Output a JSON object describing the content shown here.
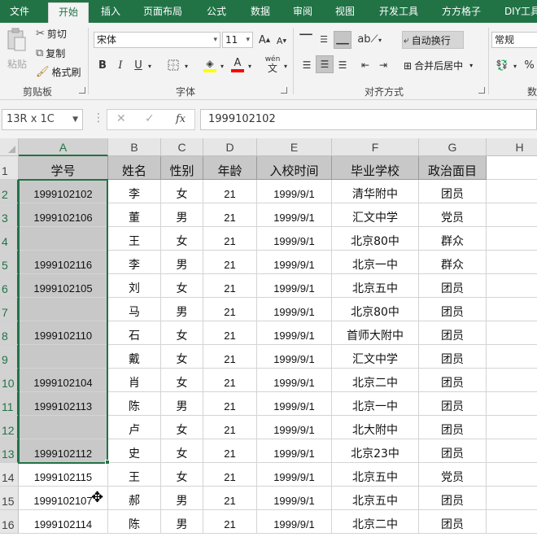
{
  "ribbon_tabs": [
    "文件",
    "开始",
    "插入",
    "页面布局",
    "公式",
    "数据",
    "审阅",
    "视图",
    "开发工具",
    "方方格子",
    "DIY工具"
  ],
  "active_tab": "开始",
  "clipboard": {
    "paste": "粘贴",
    "cut": "剪切",
    "copy": "复制",
    "format_painter": "格式刷",
    "group": "剪贴板"
  },
  "font": {
    "name": "宋体",
    "size": "11",
    "bold": "B",
    "italic": "I",
    "underline": "U",
    "phonetic": "wén",
    "group": "字体"
  },
  "alignment": {
    "wrap_text": "自动换行",
    "merge_center": "合并后居中",
    "group": "对齐方式"
  },
  "number": {
    "format": "常规",
    "group": "数"
  },
  "formula_bar": {
    "name_box": "13R x 1C",
    "fx": "fx",
    "value": "1999102102"
  },
  "columns": [
    "A",
    "B",
    "C",
    "D",
    "E",
    "F",
    "G",
    "H"
  ],
  "rows": [
    "1",
    "2",
    "3",
    "4",
    "5",
    "6",
    "7",
    "8",
    "9",
    "10",
    "11",
    "12",
    "13",
    "14",
    "15",
    "16"
  ],
  "table": {
    "headers": [
      "学号",
      "姓名",
      "性别",
      "年龄",
      "入校时间",
      "毕业学校",
      "政治面目"
    ],
    "data": [
      [
        "1999102102",
        "李",
        "女",
        "21",
        "1999/9/1",
        "清华附中",
        "团员"
      ],
      [
        "1999102106",
        "董",
        "男",
        "21",
        "1999/9/1",
        "汇文中学",
        "党员"
      ],
      [
        "",
        "王",
        "女",
        "21",
        "1999/9/1",
        "北京80中",
        "群众"
      ],
      [
        "1999102116",
        "李",
        "男",
        "21",
        "1999/9/1",
        "北京一中",
        "群众"
      ],
      [
        "1999102105",
        "刘",
        "女",
        "21",
        "1999/9/1",
        "北京五中",
        "团员"
      ],
      [
        "",
        "马",
        "男",
        "21",
        "1999/9/1",
        "北京80中",
        "团员"
      ],
      [
        "1999102110",
        "石",
        "女",
        "21",
        "1999/9/1",
        "首师大附中",
        "团员"
      ],
      [
        "",
        "戴",
        "女",
        "21",
        "1999/9/1",
        "汇文中学",
        "团员"
      ],
      [
        "1999102104",
        "肖",
        "女",
        "21",
        "1999/9/1",
        "北京二中",
        "团员"
      ],
      [
        "1999102113",
        "陈",
        "男",
        "21",
        "1999/9/1",
        "北京一中",
        "团员"
      ],
      [
        "",
        "卢",
        "女",
        "21",
        "1999/9/1",
        "北大附中",
        "团员"
      ],
      [
        "1999102112",
        "史",
        "女",
        "21",
        "1999/9/1",
        "北京23中",
        "团员"
      ],
      [
        "1999102115",
        "王",
        "女",
        "21",
        "1999/9/1",
        "北京五中",
        "党员"
      ],
      [
        "1999102107",
        "郝",
        "男",
        "21",
        "1999/9/1",
        "北京五中",
        "团员"
      ],
      [
        "1999102114",
        "陈",
        "男",
        "21",
        "1999/9/1",
        "北京二中",
        "团员"
      ]
    ]
  },
  "colors": {
    "accent": "#217346",
    "selection_fill": "#c8c8c8"
  }
}
